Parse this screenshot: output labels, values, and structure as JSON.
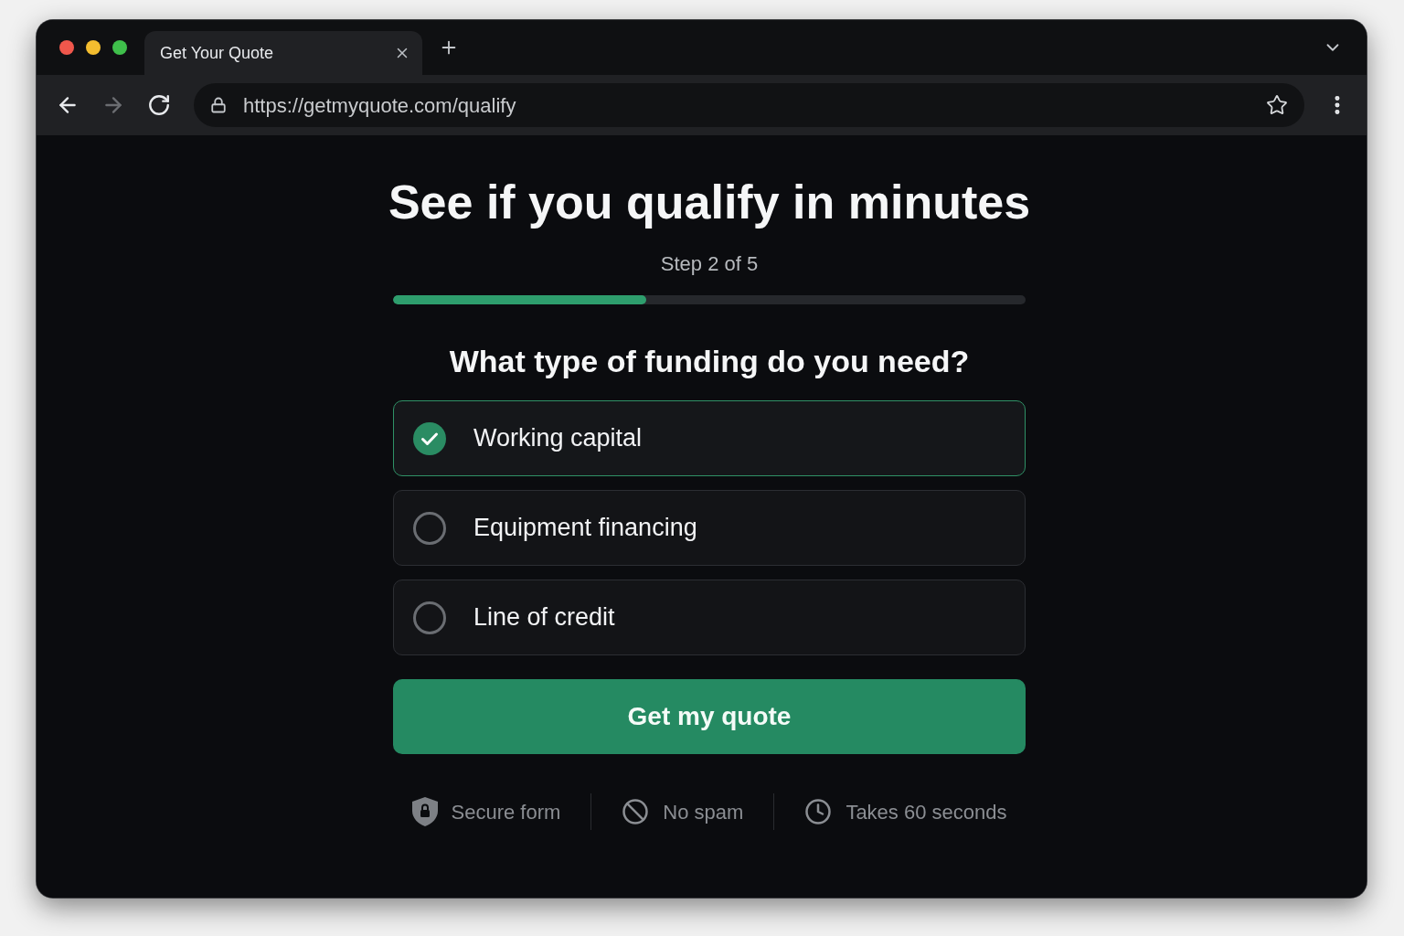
{
  "browser": {
    "tab": {
      "title": "Get Your Quote"
    },
    "nav_buttons": [
      {
        "kind": "back",
        "disabled": false
      },
      {
        "kind": "forward",
        "disabled": true
      },
      {
        "kind": "reload",
        "disabled": false
      }
    ],
    "url": "https://getmyquote.com/qualify"
  },
  "page": {
    "title": "See if you qualify in minutes",
    "step": "Step 2 of 5",
    "progress": {
      "level": 0.4
    },
    "question": "What type of funding do you need?",
    "options": [
      {
        "label": "Working capital",
        "selected": true
      },
      {
        "label": "Equipment financing",
        "selected": false
      },
      {
        "label": "Line of credit",
        "selected": false
      }
    ],
    "submit_button": "Get my quote",
    "assurances": [
      {
        "kind": "shield",
        "label": "Secure form"
      },
      {
        "kind": "ban",
        "label": "No spam"
      },
      {
        "kind": "clock",
        "label": "Takes 60 seconds"
      }
    ]
  }
}
